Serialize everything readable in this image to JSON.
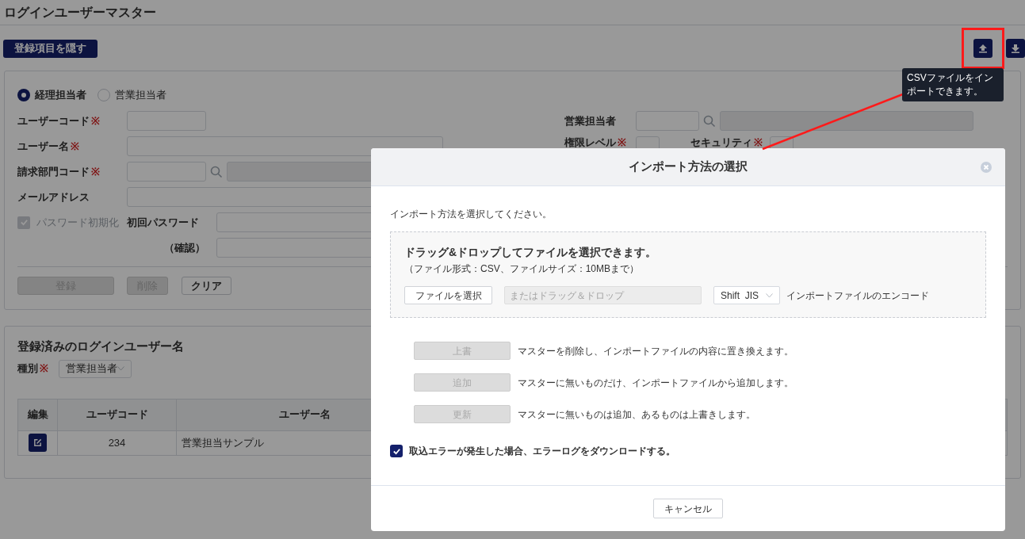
{
  "page": {
    "title": "ログインユーザーマスター"
  },
  "toolbar": {
    "toggle_button": "登録項目を隠す",
    "tooltip": "CSVファイルをインポートできます。"
  },
  "form": {
    "user_type": [
      {
        "label": "経理担当者",
        "selected": true
      },
      {
        "label": "営業担当者",
        "selected": false
      }
    ],
    "user_code": {
      "label": "ユーザーコード",
      "mark": "※"
    },
    "user_name": {
      "label": "ユーザー名",
      "mark": "※"
    },
    "billing_dept": {
      "label": "請求部門コード",
      "mark": "※"
    },
    "email": {
      "label": "メールアドレス"
    },
    "password_reset": {
      "label": "パスワード初期化",
      "checked": true,
      "disabled": true
    },
    "initial_password": {
      "label": "初回パスワード"
    },
    "confirm_password": {
      "label": "（確認）"
    },
    "sales_rep": {
      "label": "営業担当者"
    },
    "auth_level": {
      "label": "権限レベル",
      "mark": "※"
    },
    "security": {
      "label": "セキュリティ",
      "mark": "※"
    },
    "buttons": [
      {
        "label": "登録",
        "disabled": true
      },
      {
        "label": "削除",
        "disabled": true
      },
      {
        "label": "クリア",
        "disabled": false
      }
    ]
  },
  "list": {
    "title": "登録済みのログインユーザー名",
    "filter": {
      "label": "種別",
      "mark": "※",
      "value": "営業担当者"
    },
    "table": {
      "columns": [
        "編集",
        "ユーザコード",
        "ユーザー名"
      ],
      "rows": [
        {
          "user_code": "234",
          "user_name": "営業担当サンプル"
        }
      ]
    }
  },
  "dialog": {
    "title": "インポート方法の選択",
    "instruction": "インポート方法を選択してください。",
    "dropzone": {
      "title": "ドラッグ&ドロップしてファイルを選択できます。",
      "note": "（ファイル形式：CSV、ファイルサイズ：10MBまで）",
      "file_button": "ファイルを選択",
      "drop_placeholder": "またはドラッグ＆ドロップ",
      "encoding": "Shift  JIS",
      "encoding_label": "インポートファイルのエンコード"
    },
    "modes": [
      {
        "button": "上書",
        "description": "マスターを削除し、インポートファイルの内容に置き換えます。",
        "disabled": true
      },
      {
        "button": "追加",
        "description": "マスターに無いものだけ、インポートファイルから追加します。",
        "disabled": true
      },
      {
        "button": "更新",
        "description": "マスターに無いものは追加、あるものは上書きします。",
        "disabled": true
      }
    ],
    "error_log": {
      "label": "取込エラーが発生した場合、エラーログをダウンロードする。",
      "checked": true
    },
    "cancel_button": "キャンセル"
  }
}
